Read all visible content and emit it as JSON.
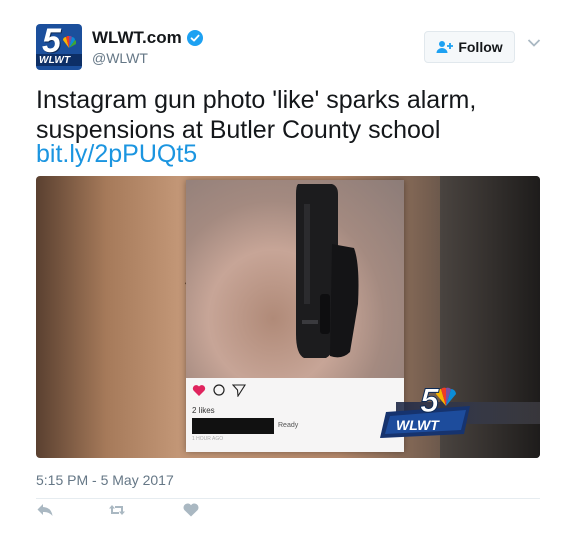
{
  "tweet": {
    "display_name": "WLWT.com",
    "handle": "@WLWT",
    "follow_label": "Follow",
    "text": "Instagram gun photo 'like' sparks alarm, suspensions at Butler County school",
    "link": "bit.ly/2pPUQt5",
    "timestamp": "5:15 PM - 5 May 2017"
  },
  "avatar": {
    "channel_number": "5",
    "call_letters": "WLWT"
  },
  "media": {
    "instagram_likes": "2 likes",
    "instagram_caption_visible": "Ready",
    "instagram_time": "1 HOUR AGO",
    "watermark_number": "5",
    "watermark_letters": "WLWT"
  },
  "icons": {
    "verified": "verified-badge-icon",
    "follow": "add-person-icon",
    "menu": "chevron-down-icon",
    "reply": "reply-icon",
    "retweet": "retweet-icon",
    "like": "heart-icon"
  },
  "colors": {
    "link": "#1b95e0",
    "verified": "#1da1f2",
    "secondary_text": "#657786",
    "action_icons": "#aab8c2"
  }
}
